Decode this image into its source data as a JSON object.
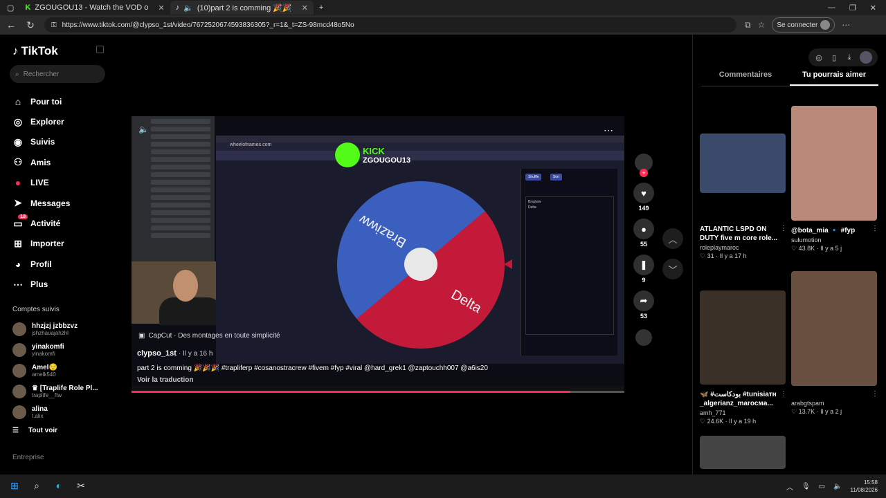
{
  "browser": {
    "tabs": [
      {
        "title": "ZGOUGOU13 - Watch the VOD o",
        "active": false
      },
      {
        "title": "(10)part 2 is comming 🎉🎉",
        "active": true
      }
    ],
    "url": "https://www.tiktok.com/@clypso_1st/video/7672520674593836305?_r=1&_t=ZS-98mcd48o5No",
    "connect_label": "Se connecter"
  },
  "sidebar": {
    "brand": "TikTok",
    "search_placeholder": "Rechercher",
    "nav": [
      {
        "label": "Pour toi",
        "icon": "home-icon"
      },
      {
        "label": "Explorer",
        "icon": "compass-icon"
      },
      {
        "label": "Suivis",
        "icon": "following-icon"
      },
      {
        "label": "Amis",
        "icon": "friends-icon"
      },
      {
        "label": "LIVE",
        "icon": "live-icon"
      },
      {
        "label": "Messages",
        "icon": "messages-icon"
      },
      {
        "label": "Activité",
        "icon": "activity-icon",
        "badge": "10"
      },
      {
        "label": "Importer",
        "icon": "upload-icon"
      },
      {
        "label": "Profil",
        "icon": "profile-icon"
      },
      {
        "label": "Plus",
        "icon": "more-icon"
      }
    ],
    "followed_title": "Comptes suivis",
    "followed": [
      {
        "name": "hhzjzj jzbbzvz",
        "handle": "jshzhauajahzhl"
      },
      {
        "name": "yinakomfi",
        "handle": "yinakomfi"
      },
      {
        "name": "Amel😌",
        "handle": "amelk540"
      },
      {
        "name": "♛ [Traplife Role Pl...",
        "handle": "traplife__ftw"
      },
      {
        "name": "alina",
        "handle": "t.alix"
      }
    ],
    "see_all": "Tout voir",
    "footer": "Entreprise"
  },
  "video": {
    "kick_label": "KICK",
    "kick_channel": "ZGOUGOU13",
    "wheel_site": "wheelofnames.com",
    "wheel_slices": [
      "Braziww",
      "Delta"
    ],
    "entries": [
      "Braziww",
      "Delta"
    ],
    "capcut": "CapCut · Des montages en toute simplicité",
    "author": "clypso_1st",
    "posted": "· Il y a 16 h",
    "caption": "part 2 is comming 🎉🎉🎉 #trapliferp #cosanostracrew #fivem #fyp #viral @hard_grek1 @zaptouchh007 @a6is20",
    "translate": "Voir la traduction",
    "progress": 0.89
  },
  "actions": {
    "likes": "149",
    "comments": "55",
    "saves": "9",
    "shares": "53"
  },
  "right_panel": {
    "tabs": [
      {
        "label": "Commentaires",
        "active": false
      },
      {
        "label": "Tu pourrais aimer",
        "active": true
      }
    ],
    "cards": [
      {
        "title": "ATLANTIC LSPD ON DUTY five m core role...",
        "user": "roleplaymaroc",
        "likes": "31",
        "time": "Il y a 17 h"
      },
      {
        "title": "@bota_mia 🔹 #fyp",
        "user": "sulumotion",
        "likes": "43.8K",
        "time": "Il y a 5 j"
      },
      {
        "title": "🦋 #بودكاست #tunisiaтн _algerianz_marocмa...",
        "user": "amh_771",
        "likes": "24.6K",
        "time": "Il y a 19 h"
      },
      {
        "title": "",
        "user": "arabgtspam",
        "likes": "13.7K",
        "time": "Il y a 2 j"
      }
    ]
  },
  "taskbar": {
    "time": "15:58",
    "date": "11/08/2026"
  }
}
